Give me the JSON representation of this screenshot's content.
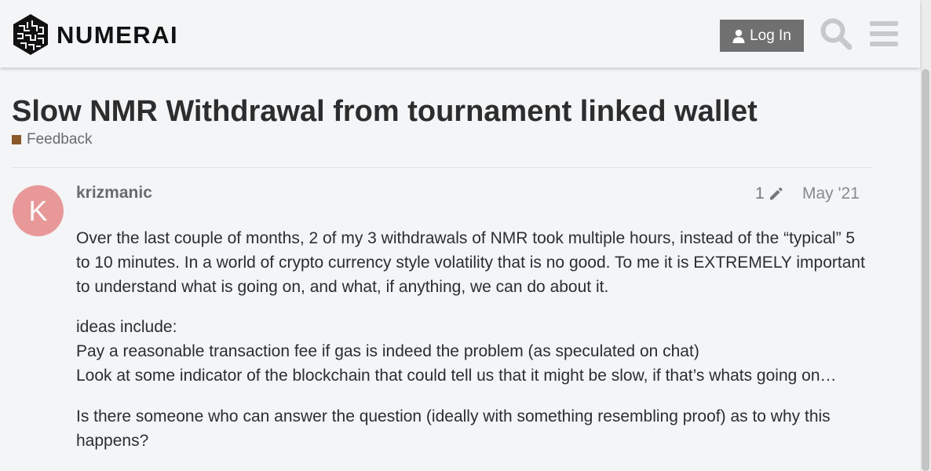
{
  "header": {
    "logo_text": "NUMERAI",
    "login_label": "Log In",
    "icons": [
      "logo-icon",
      "user-icon",
      "search-icon",
      "hamburger-menu-icon"
    ]
  },
  "topic": {
    "title": "Slow NMR Withdrawal from tournament linked wallet",
    "category": "Feedback",
    "category_color": "#8a5a2b"
  },
  "post": {
    "avatar_letter": "K",
    "avatar_color": "#e89898",
    "username": "krizmanic",
    "edit_count": "1",
    "date": "May '21",
    "paragraph1": "Over the last couple of months, 2 of my 3 withdrawals of NMR took multiple hours, instead of the “typical” 5 to 10 minutes. In a world of crypto currency style volatility that is no good. To me it is EXTREMELY important to understand what is going on, and what, if anything, we can do about it.",
    "ideas_heading": "ideas include:",
    "idea1": "Pay a reasonable transaction fee if gas is indeed the problem (as speculated on chat)",
    "idea2": "Look at some indicator of the blockchain that could tell us that it might be slow, if that’s whats going on…",
    "paragraph3": "Is there someone who can answer the question (ideally with something resembling proof) as to why this happens?"
  }
}
